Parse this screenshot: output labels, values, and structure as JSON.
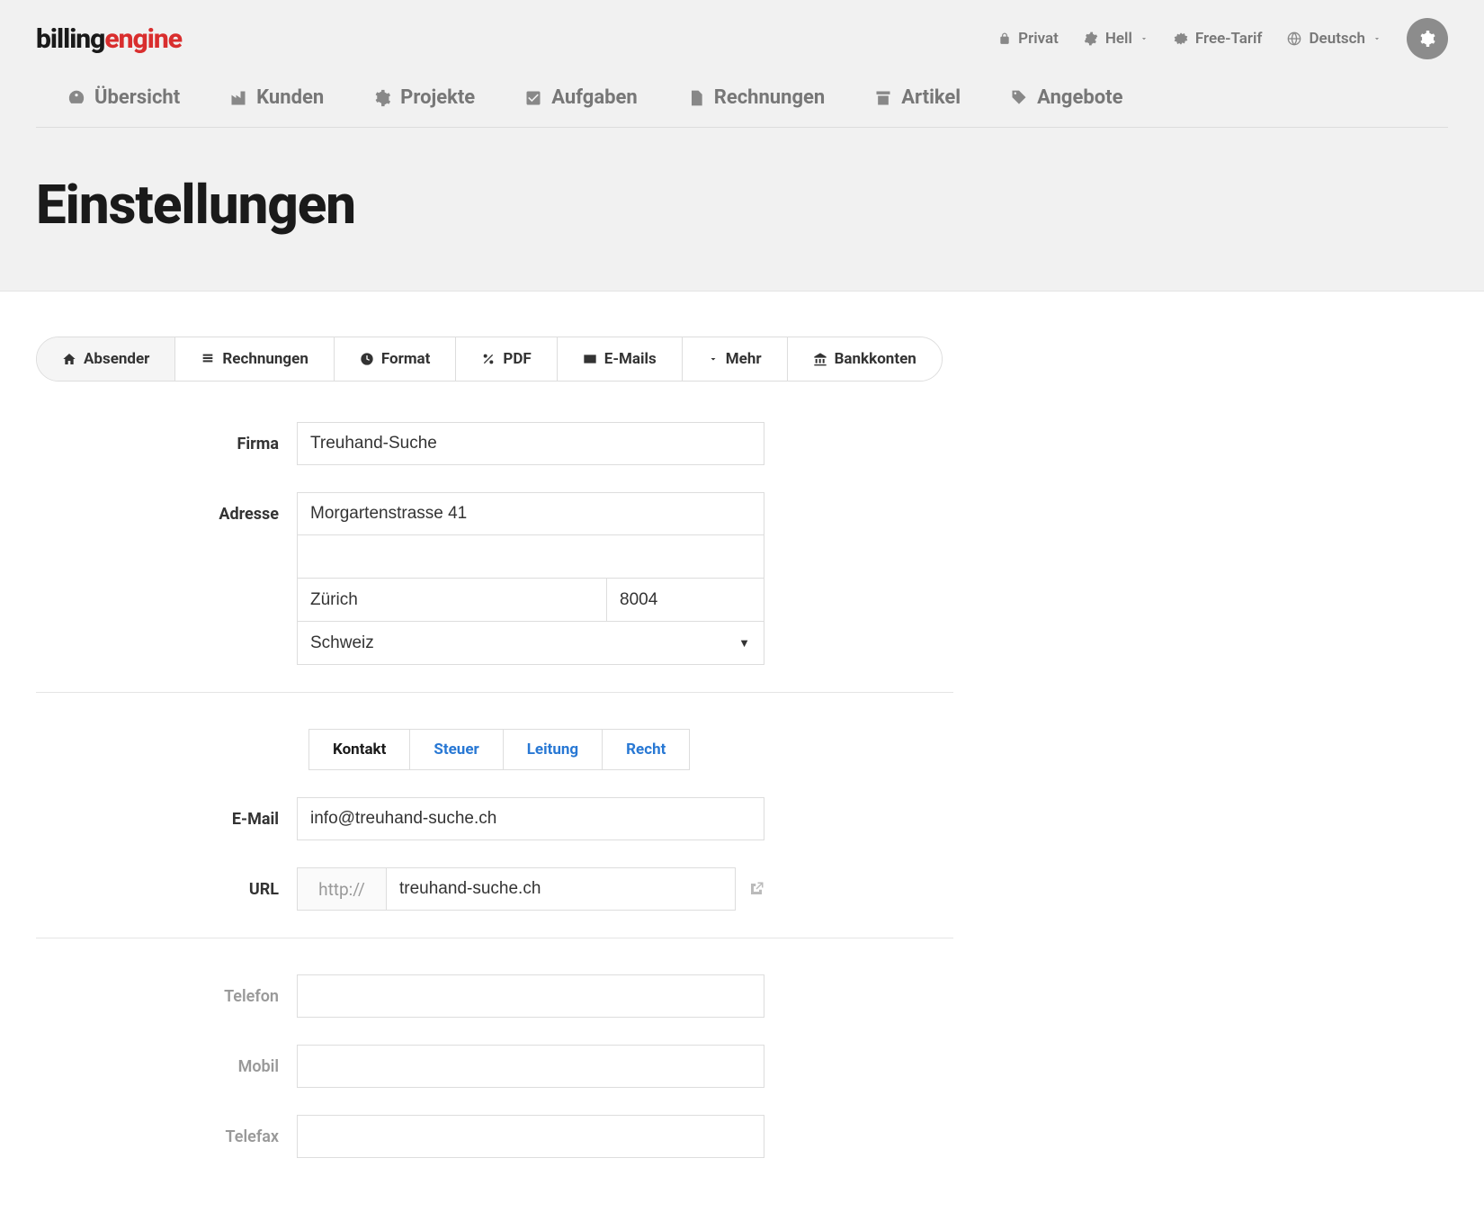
{
  "logo": {
    "part1": "billing",
    "part2": "engine"
  },
  "topLinks": {
    "privat": "Privat",
    "theme": "Hell",
    "plan": "Free-Tarif",
    "lang": "Deutsch"
  },
  "nav": {
    "overview": "Übersicht",
    "customers": "Kunden",
    "projects": "Projekte",
    "tasks": "Aufgaben",
    "invoices": "Rechnungen",
    "articles": "Artikel",
    "offers": "Angebote"
  },
  "pageTitle": "Einstellungen",
  "subtabs": {
    "sender": "Absender",
    "invoices": "Rechnungen",
    "format": "Format",
    "pdf": "PDF",
    "emails": "E-Mails",
    "more": "Mehr",
    "bank": "Bankkonten"
  },
  "labels": {
    "firma": "Firma",
    "adresse": "Adresse",
    "email": "E-Mail",
    "url": "URL",
    "telefon": "Telefon",
    "mobil": "Mobil",
    "telefax": "Telefax"
  },
  "values": {
    "firma": "Treuhand-Suche",
    "street": "Morgartenstrasse 41",
    "street2": "",
    "city": "Zürich",
    "zip": "8004",
    "country": "Schweiz",
    "email": "info@treuhand-suche.ch",
    "urlPrefix": "http://",
    "url": "treuhand-suche.ch",
    "telefon": "",
    "mobil": "",
    "telefax": ""
  },
  "innertabs": {
    "kontakt": "Kontakt",
    "steuer": "Steuer",
    "leitung": "Leitung",
    "recht": "Recht"
  }
}
